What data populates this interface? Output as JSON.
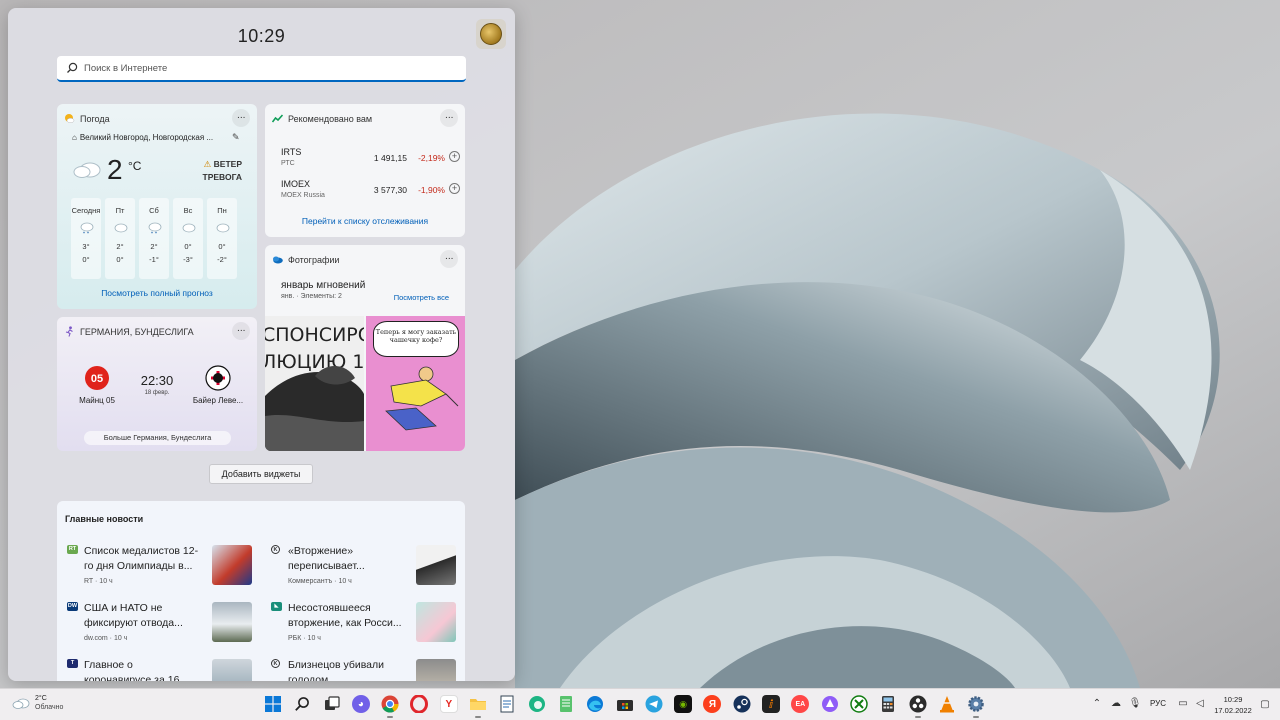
{
  "panel": {
    "clock": "10:29",
    "search_placeholder": "Поиск в Интернете"
  },
  "weather": {
    "title": "Погода",
    "location": "Великий Новгород, Новгородская ...",
    "temp": "2",
    "unit": "°C",
    "alert_line1": "ВЕТЕР",
    "alert_line2": "ТРЕВОГА",
    "days": [
      {
        "name": "Сегодня",
        "hi": "3°",
        "lo": "0°"
      },
      {
        "name": "Пт",
        "hi": "2°",
        "lo": "0°"
      },
      {
        "name": "Сб",
        "hi": "2°",
        "lo": "-1°"
      },
      {
        "name": "Вс",
        "hi": "0°",
        "lo": "-3°"
      },
      {
        "name": "Пн",
        "hi": "0°",
        "lo": "-2°"
      }
    ],
    "link": "Посмотреть полный прогноз",
    "accent": "#f3b21b"
  },
  "stocks": {
    "title": "Рекомендовано вам",
    "rows": [
      {
        "symbol": "IRTS",
        "name": "РТС",
        "price": "1 491,15",
        "change": "-2,19%"
      },
      {
        "symbol": "IMOEX",
        "name": "MOEX Russia",
        "price": "3 577,30",
        "change": "-1,90%"
      }
    ],
    "link": "Перейти к списку отслеживания",
    "negative_color": "#c42b1c"
  },
  "photos": {
    "title": "Фотографии",
    "album": "январь мгновений",
    "subtitle": "янв. · Элементы: 2",
    "see_all": "Посмотреть все",
    "img1_line1": "СПОНСИРО",
    "img1_line2": "ЛЮЦИЮ 1",
    "img2_bubble": "Теперь я могу заказать чашечку кофе?"
  },
  "football": {
    "title": "ГЕРМАНИЯ, БУНДЕСЛИГА",
    "team1": "Майнц 05",
    "team2": "Байер Леве...",
    "time": "22:30",
    "date": "18 февр.",
    "more": "Больше Германия, Бундеслига"
  },
  "add_widgets": "Добавить виджеты",
  "news": {
    "title": "Главные новости",
    "items": [
      {
        "title": "Список медалистов 12-го дня Олимпиады в...",
        "meta": "RT · 10 ч",
        "source_icon": "rt",
        "color": "#6aa84f"
      },
      {
        "title": "«Вторжение» переписывает...",
        "meta": "Коммерсантъ · 10 ч",
        "source_icon": "kommersant",
        "color": "#333333"
      },
      {
        "title": "США и НАТО не фиксируют отвода...",
        "meta": "dw.com · 10 ч",
        "source_icon": "dw",
        "color": "#0a3a78"
      },
      {
        "title": "Несостоявшееся вторжение, как Росси...",
        "meta": "РБК · 10 ч",
        "source_icon": "rbc",
        "color": "#1a8e7a"
      },
      {
        "title": "Главное о коронавирусе за 16...",
        "meta": "",
        "source_icon": "tass",
        "color": "#1e2a6e"
      },
      {
        "title": "Близнецов убивали голодом",
        "meta": "",
        "source_icon": "kommersant",
        "color": "#333333"
      }
    ]
  },
  "taskbar": {
    "weather_temp": "2°C",
    "weather_desc": "Облачно",
    "lang": "РУС",
    "time": "10:29",
    "date": "17.02.2022",
    "apps": [
      "start",
      "search-icon",
      "task-view-icon",
      "chat-icon",
      "chrome-icon",
      "opera-icon",
      "yandex-browser-icon",
      "file-explorer-icon",
      "notepad-icon",
      "edge-beta-icon",
      "notepad2-icon",
      "edge-icon",
      "store-icon",
      "telegram-icon",
      "nvidia-icon",
      "yandex-icon",
      "steam-icon",
      "unreal-icon",
      "ea-icon",
      "alice-icon",
      "xbox-icon",
      "calculator-icon",
      "obs-icon",
      "vlc-icon",
      "settings-icon"
    ]
  }
}
